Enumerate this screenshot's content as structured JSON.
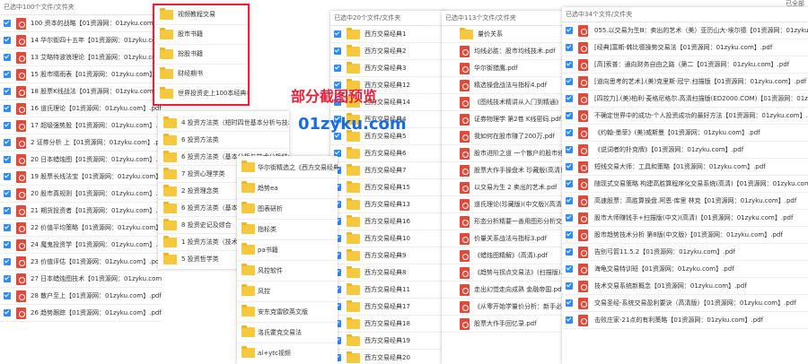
{
  "top_right": "已全部",
  "panel1": {
    "header": "已选中100个文件/文件夹",
    "items": [
      "100 资本的战略【01资源网：01zyku.com】.pdf",
      "14 华尔街四十五年【01资源网：01zyku.com】.pdf",
      "13 艾略特波浪理论【01资源网：01zyku.com】.pdf",
      "15 股市晴雨表【01资源网：01zyku.com】.pdf",
      "18 股票K线战法【01资源网：01zyku.com】.pdf",
      "16 道氏理论【01资源网：01zyku.com】.pdf",
      "17 超级强势股【01资源网：01zyku.com】.pdf",
      "2 证券分析 上【01资源网：01zyku.com】.pdf",
      "20 日本蜡烛图【01资源网：01zyku.com】.pdf",
      "19 股票长线法宝【01资源网：01zyku.com】.pdf",
      "20 股市真规则【01资源网：01zyku.com】.pdf",
      "21 期货投资者【01资源网：01zyku.com】.pdf",
      "22 价值平均策略【01资源网：01zyku.com】.pdf",
      "24 魔鬼投资学【01资源网：01zyku.com】.pdf",
      "23 价值评估【01资源网：01zyku.com】.pdf",
      "27 日本蜡烛图技术【01资源网：01zyku.com】.pdf",
      "28 散户至上【01资源网：01zyku.com】.pdf",
      "26 趋势跟踪【01资源网：01zyku.com】.pdf"
    ]
  },
  "panel2": {
    "items": [
      "视频教程交易",
      "股市书籍",
      "扮股书籍",
      "财经期书",
      "世界投资史上100本经典名著"
    ]
  },
  "panel3": {
    "items": [
      "4 投资方法类（短时四世基本分析与技术分析）",
      "6 投资方法类",
      "6 投资方法类（基本分析与技术分析结合）",
      "7 投资心理学类",
      "2 投资理念类",
      "6 投资方法类（基本面分析）",
      "8 投资史记及综合",
      "1 投资方法类（技术分析）",
      "5 投资哲学类"
    ]
  },
  "panel4": {
    "items": [
      "华尔街精选之《西方交易经典》",
      "趋势ea",
      "图表研析",
      "指标类",
      "pa书籍",
      "风控软件",
      "风控",
      "安东克雷欧英文版",
      "洛氏霍克交易法",
      "al+ytc视频"
    ]
  },
  "panel5": {
    "header": "已选中20个文件/文件夹",
    "items": [
      "西方交易经典1",
      "西方交易经典2",
      "西方交易经典3",
      "西方交易经典12",
      "西方交易经典14",
      "西方交易经典4",
      "西方交易经典5",
      "西方交易经典6",
      "西方交易经典7",
      "西方交易经典15",
      "西方交易经典13",
      "西方交易经典16",
      "西方交易经典10",
      "西方交易经典9",
      "西方交易经典8",
      "西方交易经典11",
      "西方交易经典17",
      "西方交易经典18",
      "西方交易经典19",
      "西方交易经典20"
    ]
  },
  "panel6": {
    "header": "已选中113个文件/文件夹",
    "items": [
      "量价关系",
      "均线必胜：股市均线技术.pdf",
      "华尔街猎鹰.pdf",
      "精选操盘战法与指标4.pdf",
      "《图线技术精讲从入门到精通》.pdf",
      "证券物理学 第2卷 K线密码.pdf",
      "我如何在股市赚了200万.pdf",
      "股市进阶之道 一个散户的股市修养.pdf",
      "股票大作手操盘术 珍藏版(高清).pdf",
      "以交易为生 2 卖出的艺术.pdf",
      "道氏理论(珍藏版)(中文版)(高清)PDF",
      "形态分析精要一善用图形分析交易",
      "价量关系战法与指标3.pdf",
      "《蜡烛图精解》(高清).pdf",
      "《趋势与拐点交易法》(扫描版).pdf",
      "走出幻觉走向成熟 金融帝国.pdf",
      "《从零开始学量价分析：新手必读》.pdf",
      "股票大作手回忆录.pdf"
    ]
  },
  "panel7": {
    "header": "已选中34个文件/文件夹",
    "items": [
      "055.以交易为生Ⅲ：卖出的艺术（美）亚历山大·埃尔德【01资源网：01zyku.com】.pdf",
      "[经典]富斯·韩比德操势交易法【01资源网：01zyku.com】.pdf",
      "[高]索普：通向财务自由之路（第二【01资源网：01zyku.com】.pdf",
      "[道向思考的艺术].(美)克里斯·冠宁.扫描版【01资源网：01zyku.com】.pdf",
      "[四控力].(美)柏利·麦格尼格尔.高清扫描版(ED2000.COM)【01资源网：01zyku.com】.pdf",
      "不确定世界中的成功-个人投资成功的最好方法【01资源网：01zyku.com】.pdf",
      "《约翰-墨菲》(美)威斯曼【01资源网：01zyku.com】.pdf",
      "《说词者的扑克牌》【01资源网：01zyku.com】.pdf",
      "短线交易大师：工具和策略【01资源网：01zyku.com】.pdf",
      "随现式交易策略 构建高胜算程序化交易系统(高清)【01资源网：01zyku.com】.pdf",
      "高速股票：高胜算操盘.阿恩·库里 林克【01资源网：01zyku.com】.pdf",
      "股市大师赚钱手+扫描版(中文)(高清)【01资源网：01zyku.com】.pdf",
      "股市趋势技术分析 第8版(中文版)【01资源网：01zyku.com】.pdf",
      "告别弓箭11.5.2【01资源网：01zyku.com】.pdf",
      "海龟交易特训班【01资源网：01zyku.com】.pdf",
      "技术交易系统新概念【01资源网：01zyku.com】.pdf",
      "交易圣经-系统交易盈利要诀（高清版）【01资源网：01zyku.com】.pdf",
      "击败庄家-21点的有利策略【01资源网：01zyku.com】.pdf"
    ]
  },
  "watermark_title": "部分截图预览",
  "watermark_site": "01zyku.com",
  "colors": {
    "accent_red": "#e8203a",
    "site_blue": "#1a6be0",
    "check_blue": "#2f8bf5",
    "folder_yellow": "#f5c83d",
    "pdf_red": "#e04a3b"
  }
}
